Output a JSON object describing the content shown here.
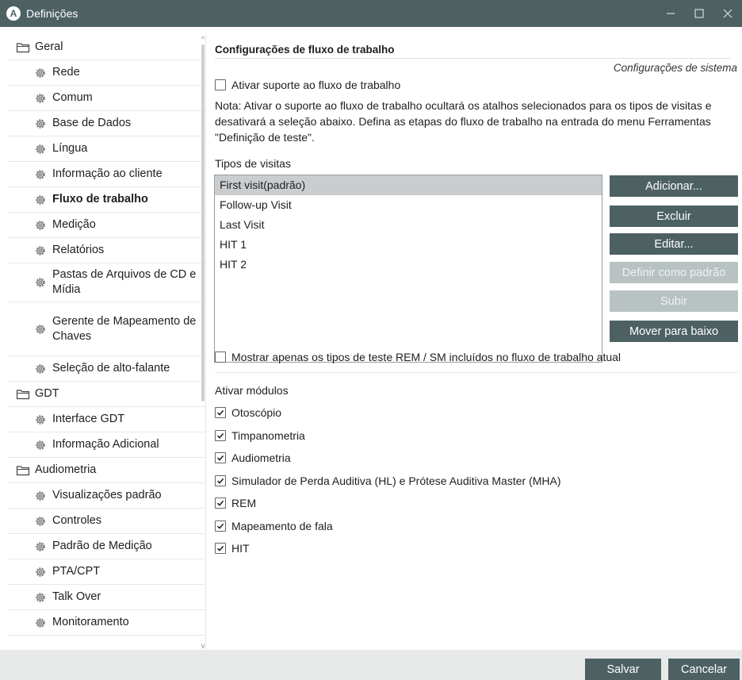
{
  "window": {
    "title": "Definições",
    "app_icon_letter": "A",
    "controls": {
      "minimize": "–",
      "maximize": "☐",
      "close": "✕"
    }
  },
  "sidebar": {
    "items": [
      {
        "label": "Geral",
        "level": 0,
        "icon": "folder-icon"
      },
      {
        "label": "Rede",
        "level": 1,
        "icon": "gear-icon"
      },
      {
        "label": "Comum",
        "level": 1,
        "icon": "gear-icon"
      },
      {
        "label": "Base de Dados",
        "level": 1,
        "icon": "gear-icon"
      },
      {
        "label": "Língua",
        "level": 1,
        "icon": "gear-icon"
      },
      {
        "label": "Informação ao cliente",
        "level": 1,
        "icon": "gear-icon"
      },
      {
        "label": "Fluxo de trabalho",
        "level": 1,
        "icon": "gear-icon",
        "selected": true
      },
      {
        "label": "Medição",
        "level": 1,
        "icon": "gear-icon"
      },
      {
        "label": "Relatórios",
        "level": 1,
        "icon": "gear-icon"
      },
      {
        "label": "Pastas de Arquivos de CD e Mídia",
        "level": 1,
        "icon": "gear-icon"
      },
      {
        "label": "Gerente de Mapeamento de Chaves",
        "level": 1,
        "icon": "gear-icon"
      },
      {
        "label": "Seleção de alto-falante",
        "level": 1,
        "icon": "gear-icon"
      },
      {
        "label": "GDT",
        "level": 0,
        "icon": "folder-icon"
      },
      {
        "label": "Interface GDT",
        "level": 1,
        "icon": "gear-icon"
      },
      {
        "label": "Informação Adicional",
        "level": 1,
        "icon": "gear-icon"
      },
      {
        "label": "Audiometria",
        "level": 0,
        "icon": "folder-icon"
      },
      {
        "label": "Visualizações padrão",
        "level": 1,
        "icon": "gear-icon"
      },
      {
        "label": "Controles",
        "level": 1,
        "icon": "gear-icon"
      },
      {
        "label": "Padrão de Medição",
        "level": 1,
        "icon": "gear-icon"
      },
      {
        "label": "PTA/CPT",
        "level": 1,
        "icon": "gear-icon"
      },
      {
        "label": "Talk Over",
        "level": 1,
        "icon": "gear-icon"
      },
      {
        "label": "Monitoramento",
        "level": 1,
        "icon": "gear-icon"
      }
    ]
  },
  "main": {
    "section_title": "Configurações de fluxo de trabalho",
    "system_label": "Configurações de sistema",
    "enable_workflow": {
      "label": "Ativar suporte ao fluxo de trabalho",
      "checked": false
    },
    "note": "Nota: Ativar o suporte ao fluxo de trabalho ocultará os atalhos selecionados para os tipos de visitas e desativará a seleção abaixo. Defina as etapas do fluxo de trabalho na entrada do menu Ferramentas \"Definição de teste\".",
    "visit_types_label": "Tipos de visitas",
    "visit_types": [
      {
        "label": "First visit(padrão)",
        "selected": true
      },
      {
        "label": "Follow-up Visit"
      },
      {
        "label": "Last Visit"
      },
      {
        "label": "HIT 1"
      },
      {
        "label": "HIT 2"
      }
    ],
    "buttons": {
      "add": "Adicionar...",
      "delete": "Excluir",
      "edit": "Editar...",
      "set_default": "Definir como padrão",
      "move_up": "Subir",
      "move_down": "Mover para baixo"
    },
    "show_only": {
      "label": "Mostrar apenas os tipos de teste REM / SM incluídos no fluxo de trabalho atual",
      "checked": false
    },
    "modules_label": "Ativar módulos",
    "modules": [
      {
        "label": "Otoscópio",
        "checked": true
      },
      {
        "label": "Timpanometria",
        "checked": true
      },
      {
        "label": "Audiometria",
        "checked": true
      },
      {
        "label": "Simulador de Perda Auditiva (HL) e Prótese Auditiva Master (MHA)",
        "checked": true
      },
      {
        "label": "REM",
        "checked": true
      },
      {
        "label": "Mapeamento de fala",
        "checked": true
      },
      {
        "label": "HIT",
        "checked": true
      }
    ]
  },
  "footer": {
    "save": "Salvar",
    "cancel": "Cancelar"
  },
  "colors": {
    "titlebar": "#4d6163",
    "button": "#4d6163",
    "button_disabled": "#b9c2c3",
    "selection": "#c9cdcf",
    "footer": "#e8eaea"
  }
}
